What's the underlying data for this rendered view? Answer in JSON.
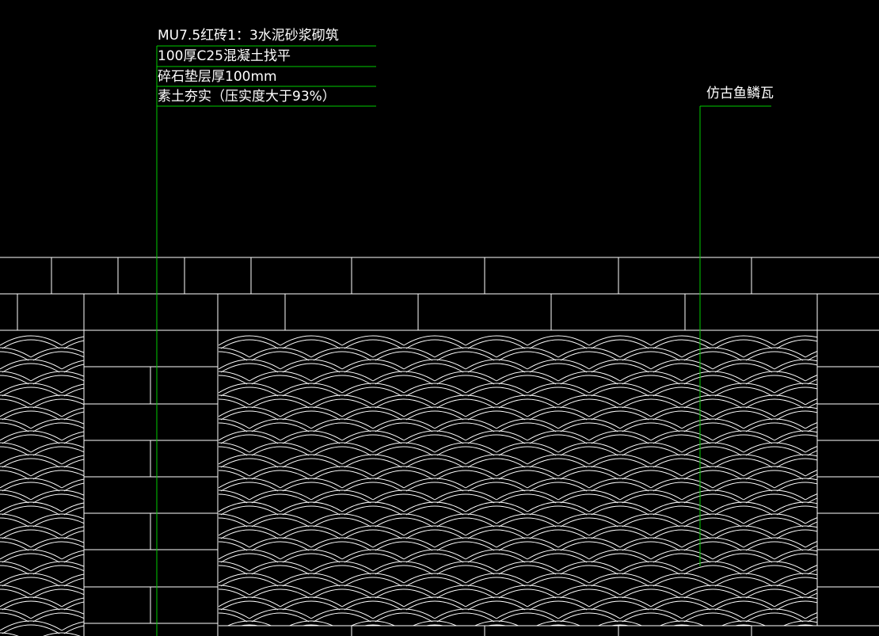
{
  "callout_left": {
    "lines": [
      "MU7.5红砖1：3水泥砂浆砌筑",
      "100厚C25混凝土找平",
      "碎石垫层厚100mm",
      "素土夯实（压实度大于93%）"
    ]
  },
  "callout_right": {
    "text": "仿古鱼鳞瓦"
  },
  "colors": {
    "background": "#000000",
    "linework": "#ffffff",
    "leader": "#00cc00"
  }
}
